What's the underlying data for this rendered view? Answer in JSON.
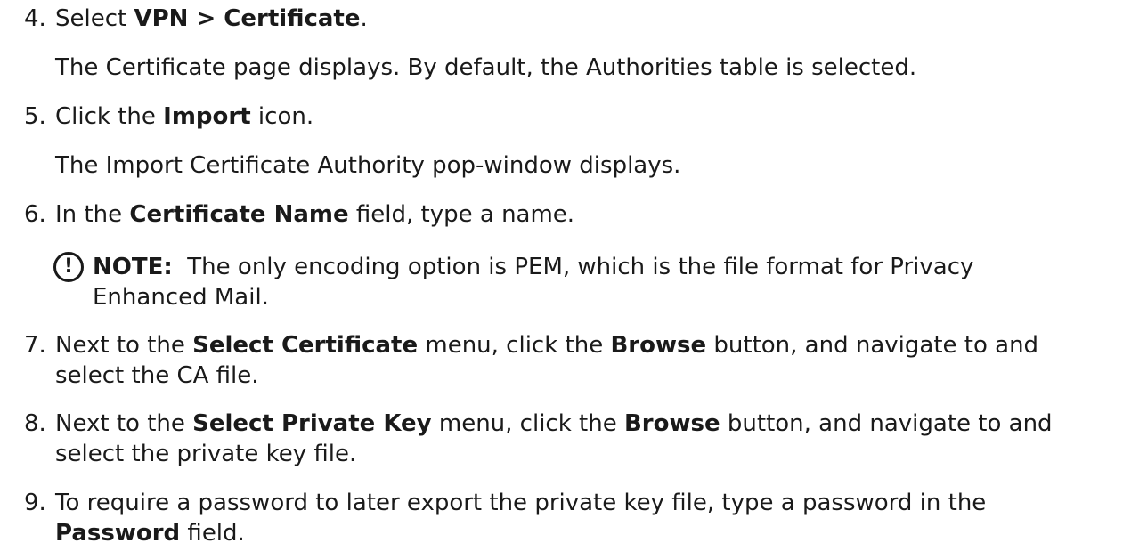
{
  "steps": [
    {
      "num": "4.",
      "pre": "Select ",
      "bold": "VPN > Certificate",
      "post": ".",
      "desc": "The Certificate page displays. By default, the Authorities table is selected."
    },
    {
      "num": "5.",
      "pre": "Click the ",
      "bold": "Import",
      "post": " icon.",
      "desc": "The Import Certificate Authority pop-window displays."
    },
    {
      "num": "6.",
      "pre": "In the ",
      "bold": "Certificate Name",
      "post": " field, type a name."
    },
    {
      "num": "7.",
      "pre": "Next to the ",
      "bold": "Select Certificate",
      "mid": " menu, click the ",
      "bold2": "Browse",
      "post": " button, and navigate to and",
      "cont": "select the CA file."
    },
    {
      "num": "8.",
      "pre": "Next to the ",
      "bold": "Select Private Key",
      "mid": " menu, click the ",
      "bold2": "Browse",
      "post": " button, and navigate to and",
      "cont": "select the private key file."
    },
    {
      "num": "9.",
      "pre": "To require a password to later export the private key file, type a password in the",
      "bold": "Password",
      "post": " field."
    }
  ],
  "note": {
    "icon": "!",
    "label": "NOTE:",
    "line1": "  The only encoding option is PEM, which is the file format for Privacy",
    "line2": "Enhanced Mail."
  }
}
